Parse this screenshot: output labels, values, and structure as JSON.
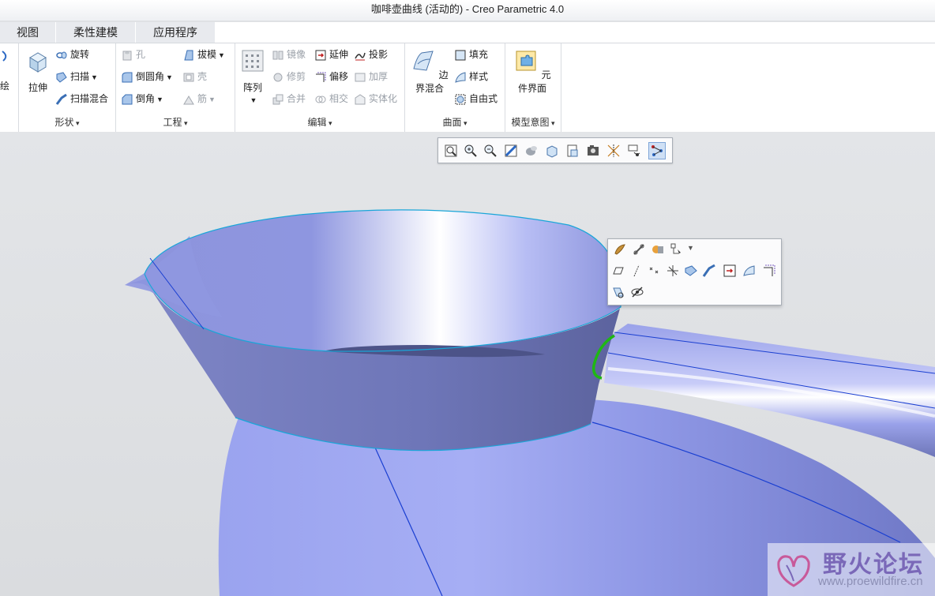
{
  "window": {
    "title": "咖啡壶曲线 (活动的) - Creo Parametric 4.0"
  },
  "tabs": [
    {
      "label": "视图"
    },
    {
      "label": "柔性建模"
    },
    {
      "label": "应用程序"
    }
  ],
  "ribbon": {
    "shape": {
      "label": "形状",
      "extrude": "拉伸",
      "revolve": "旋转",
      "sweep": "扫描",
      "swept_blend": "扫描混合"
    },
    "engineering": {
      "label": "工程",
      "hole": "孔",
      "draft": "拔模",
      "round": "倒圆角",
      "shell": "壳",
      "chamfer": "倒角",
      "rib": "筋"
    },
    "editing": {
      "label": "编辑",
      "pattern": "阵列",
      "mirror": "镜像",
      "extend": "延伸",
      "project": "投影",
      "trim": "修剪",
      "offset": "偏移",
      "thicken": "加厚",
      "merge": "合并",
      "intersect": "相交",
      "solidify": "实体化"
    },
    "surfaces": {
      "label": "曲面",
      "boundary_blend": "边界混合",
      "fill": "填充",
      "style": "样式",
      "freestyle": "自由式"
    },
    "model_intent": {
      "label": "模型意图",
      "component_interface": "元件界面"
    },
    "left_cut": {
      "sketch": "绘"
    }
  },
  "graphics_toolbar": {
    "icons": [
      "refit-icon",
      "zoom-in-icon",
      "zoom-out-icon",
      "repaint-icon",
      "perspective-icon",
      "display-style-icon",
      "saved-orientations-icon",
      "view-manager-icon",
      "datum-display-icon",
      "annotation-display-icon",
      "spin-center-icon"
    ]
  },
  "mini_toolbar": {
    "row1": [
      "appearance-icon",
      "chain-icon",
      "shade-icon",
      "selection-filter-icon"
    ],
    "row2": [
      "plane-icon",
      "axis-icon",
      "point-icon",
      "csys-icon",
      "sweep-icon",
      "boundary-icon",
      "extend-icon",
      "fill-icon",
      "offset-icon"
    ],
    "row3": [
      "hide-icon",
      "visibility-icon"
    ]
  },
  "watermark": {
    "title": "野火论坛",
    "url": "www.proewildfire.cn"
  },
  "colors": {
    "surface": "#8f98e6",
    "edge": "#1aa6d8",
    "highlight_curve": "#1fb814",
    "datum_line": "#1a3fd1"
  }
}
